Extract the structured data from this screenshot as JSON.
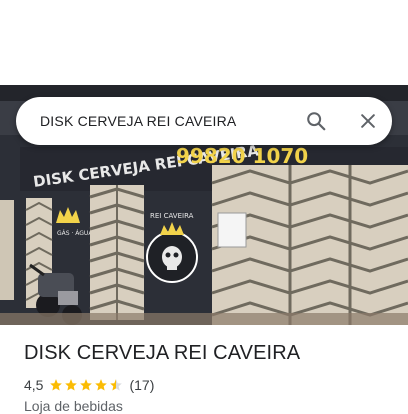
{
  "search": {
    "query": "DISK CERVEJA REI CAVEIRA",
    "search_icon": "search-icon",
    "close_icon": "close-icon"
  },
  "place": {
    "name": "DISK CERVEJA REI CAVEIRA",
    "rating": "4,5",
    "rating_stars": 4.5,
    "reviews": "(17)",
    "category": "Loja de bebidas"
  },
  "photo": {
    "sign_text": "DISK CERVEJA REI CAVEIRA",
    "phone_text": "99820 1070",
    "logo_text": "REI CAVEIRA",
    "side_text": "GÁS · ÁGUA · GELO"
  },
  "colors": {
    "star": "#fbbc04",
    "wall": "#2c2f37",
    "gate": "#d8cfbf",
    "sign_yellow": "#f2d34a"
  }
}
